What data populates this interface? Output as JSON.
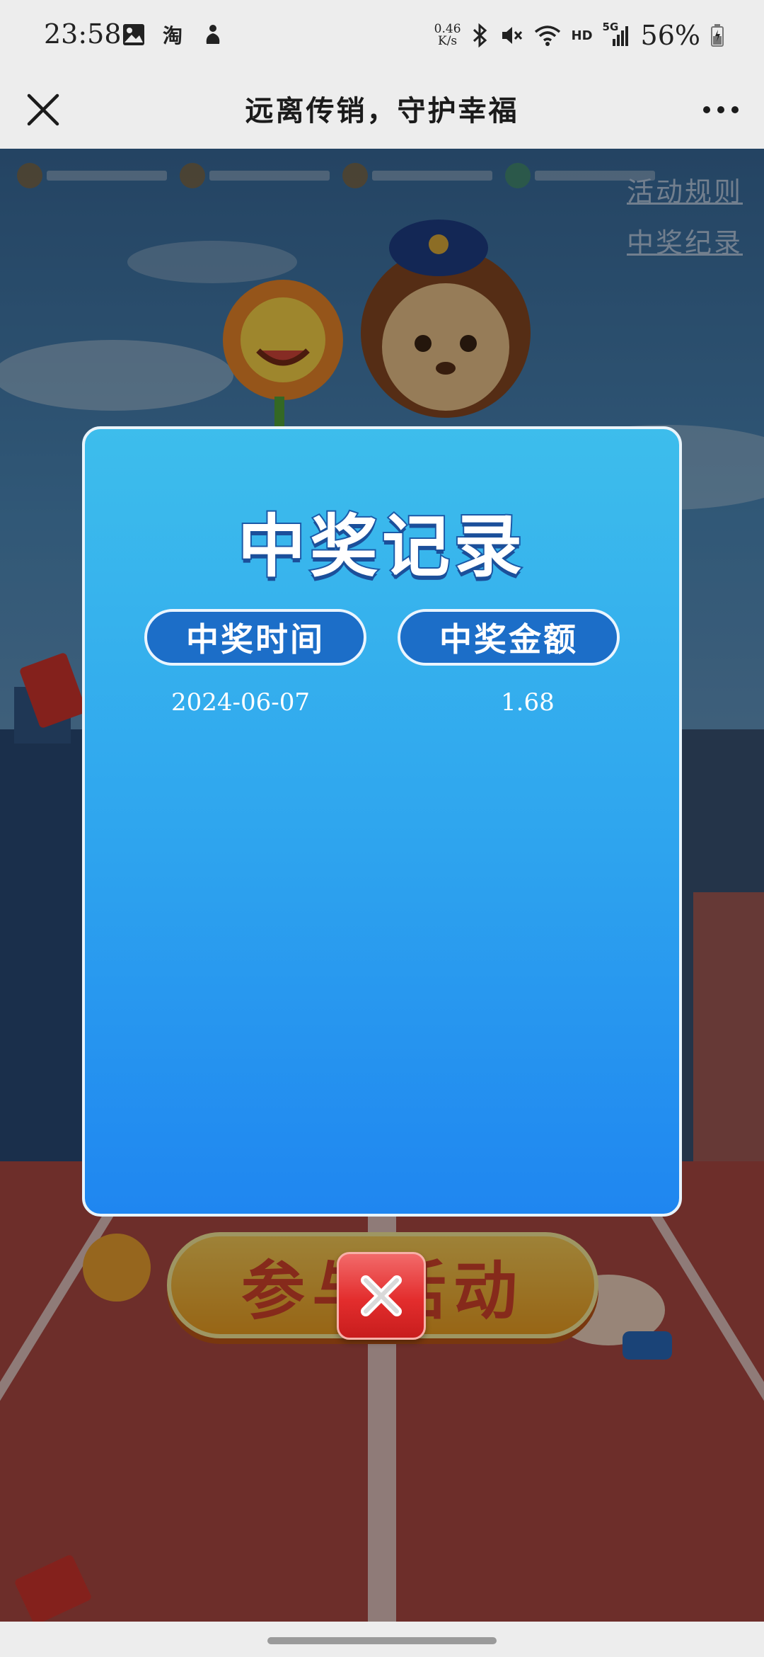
{
  "status_bar": {
    "time": "23:58",
    "left_icons": [
      "image-icon",
      "taobao-icon",
      "app-icon"
    ],
    "network_speed_value": "0.46",
    "network_speed_unit": "K/s",
    "hd_label": "HD",
    "signal_label": "5G",
    "battery_percent": "56%"
  },
  "nav": {
    "title": "远离传销，守护幸福"
  },
  "page": {
    "rules_link": "活动规则",
    "records_link": "中奖纪录",
    "join_button": "参与活动"
  },
  "modal": {
    "title": "中奖记录",
    "headers": {
      "time": "中奖时间",
      "amount": "中奖金额"
    },
    "records": [
      {
        "date": "2024-06-07",
        "amount": "1.68"
      }
    ]
  },
  "colors": {
    "modal_top": "#3dbdec",
    "modal_bottom": "#1f86f0",
    "header_pill": "#1c6ec8",
    "close_red": "#e32d2d"
  }
}
